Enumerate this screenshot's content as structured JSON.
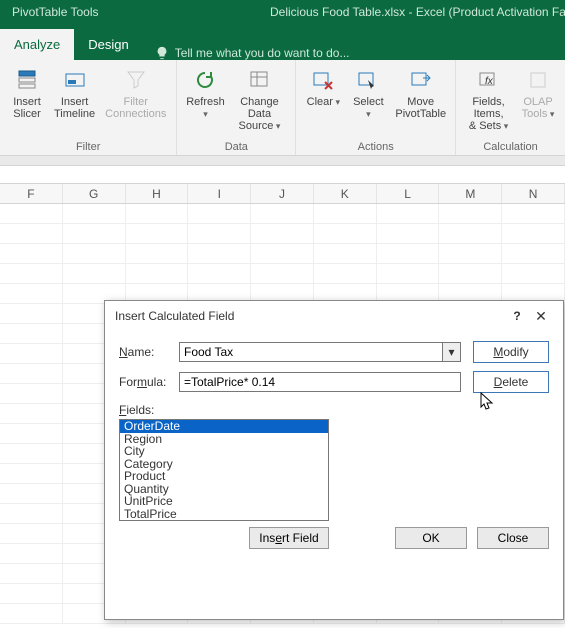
{
  "titlebar": {
    "tools_title": "PivotTable Tools",
    "doc_title": "Delicious Food Table.xlsx - Excel (Product Activation Fa"
  },
  "tabs": {
    "analyze": "Analyze",
    "design": "Design",
    "tellme": "Tell me what you do want to do..."
  },
  "ribbon": {
    "insert_slicer": "Insert\nSlicer",
    "insert_timeline": "Insert\nTimeline",
    "filter_connections": "Filter\nConnections",
    "refresh": "Refresh",
    "change_data_source": "Change Data\nSource",
    "clear": "Clear",
    "select": "Select",
    "move_pivottable": "Move\nPivotTable",
    "fields_items_sets": "Fields, Items,\n& Sets",
    "olap_tools": "OLAP\nTools",
    "group_filter": "Filter",
    "group_data": "Data",
    "group_actions": "Actions",
    "group_calculations": "Calculation"
  },
  "columns": [
    "F",
    "G",
    "H",
    "I",
    "J",
    "K",
    "L",
    "M",
    "N"
  ],
  "dialog": {
    "title": "Insert Calculated Field",
    "name_label": "Name:",
    "name_value": "Food Tax",
    "formula_label": "Formula:",
    "formula_value": "=TotalPrice* 0.14",
    "modify": "Modify",
    "delete": "Delete",
    "fields_label": "Fields:",
    "fields": [
      "OrderDate",
      "Region",
      "City",
      "Category",
      "Product",
      "Quantity",
      "UnitPrice",
      "TotalPrice"
    ],
    "insert_field": "Insert Field",
    "ok": "OK",
    "close": "Close"
  }
}
